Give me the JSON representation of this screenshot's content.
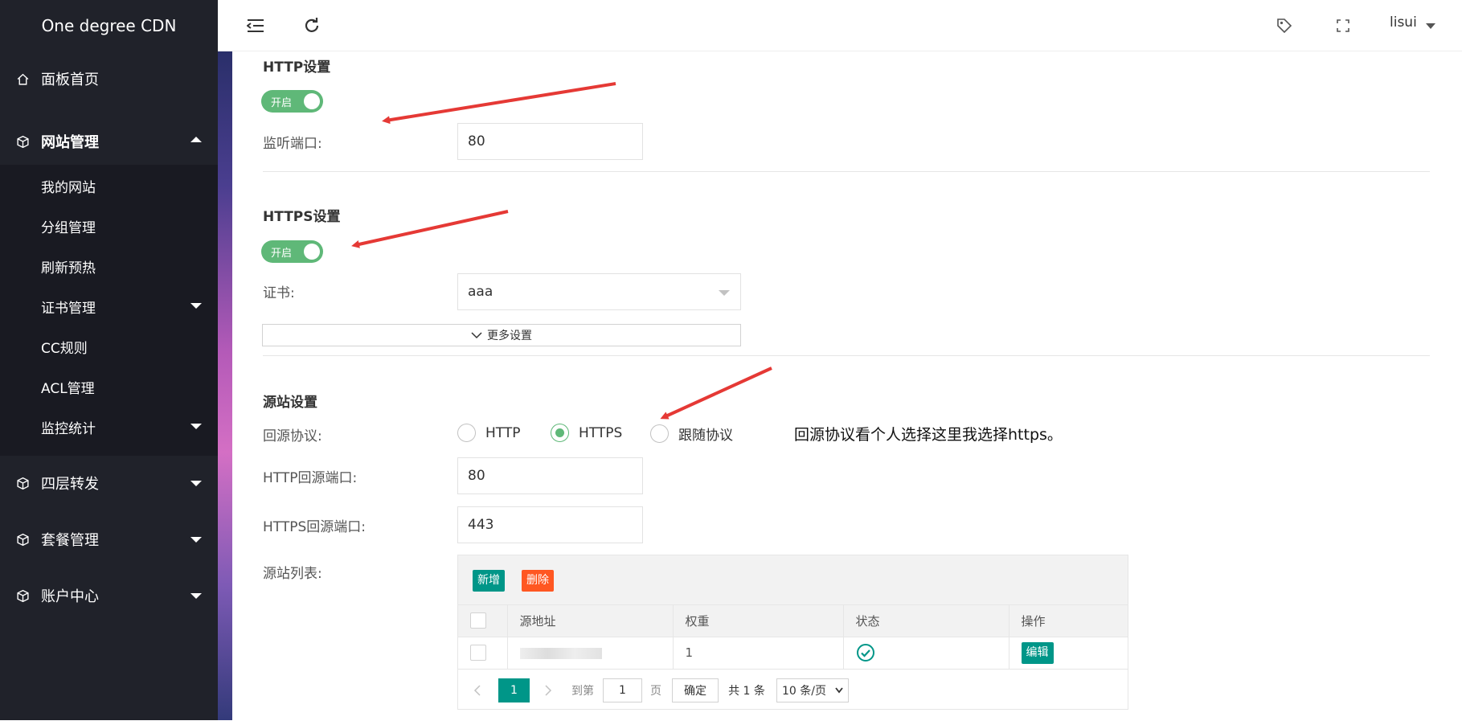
{
  "brand": "One degree CDN",
  "nav": {
    "home": "面板首页",
    "site_mgmt": "网站管理",
    "sub": [
      "我的网站",
      "分组管理",
      "刷新预热",
      "证书管理",
      "CC规则",
      "ACL管理",
      "监控统计"
    ],
    "l4": "四层转发",
    "plans": "套餐管理",
    "account": "账户中心"
  },
  "header": {
    "user": "lisui"
  },
  "http": {
    "title": "HTTP设置",
    "switch": "开启",
    "port_label": "监听端口:",
    "port_value": "80"
  },
  "https": {
    "title": "HTTPS设置",
    "switch": "开启",
    "cert_label": "证书:",
    "cert_value": "aaa",
    "more": "更多设置"
  },
  "origin": {
    "title": "源站设置",
    "protocol_label": "回源协议:",
    "options": [
      "HTTP",
      "HTTPS",
      "跟随协议"
    ],
    "selected": "HTTPS",
    "note": "回源协议看个人选择这里我选择https。",
    "http_port_label": "HTTP回源端口:",
    "http_port": "80",
    "https_port_label": "HTTPS回源端口:",
    "https_port": "443",
    "list_label": "源站列表:"
  },
  "table": {
    "add": "新增",
    "delete": "删除",
    "headers": [
      "源地址",
      "权重",
      "状态",
      "操作"
    ],
    "rows": [
      {
        "address": "",
        "weight": "1",
        "status": "ok",
        "action": "编辑"
      }
    ],
    "pager": {
      "page": "1",
      "goto": "到第",
      "page_input": "1",
      "page_unit": "页",
      "confirm": "确定",
      "total": "共 1 条",
      "per_page": "10 条/页"
    }
  },
  "colors": {
    "sidebar": "#20222a",
    "green": "#5fb878",
    "teal": "#009688",
    "orange": "#ff5722",
    "arrow": "#e53935"
  }
}
